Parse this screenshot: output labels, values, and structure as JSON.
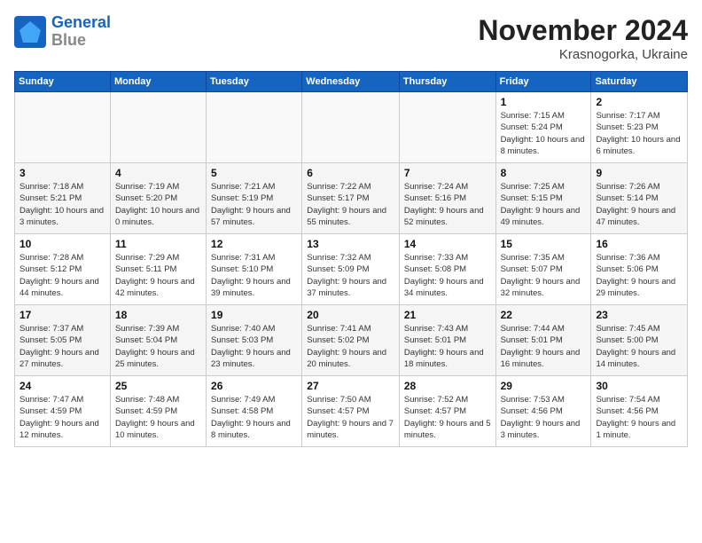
{
  "logo": {
    "line1": "General",
    "line2": "Blue"
  },
  "title": "November 2024",
  "location": "Krasnogorka, Ukraine",
  "days_header": [
    "Sunday",
    "Monday",
    "Tuesday",
    "Wednesday",
    "Thursday",
    "Friday",
    "Saturday"
  ],
  "weeks": [
    [
      {
        "day": "",
        "info": ""
      },
      {
        "day": "",
        "info": ""
      },
      {
        "day": "",
        "info": ""
      },
      {
        "day": "",
        "info": ""
      },
      {
        "day": "",
        "info": ""
      },
      {
        "day": "1",
        "info": "Sunrise: 7:15 AM\nSunset: 5:24 PM\nDaylight: 10 hours and 8 minutes."
      },
      {
        "day": "2",
        "info": "Sunrise: 7:17 AM\nSunset: 5:23 PM\nDaylight: 10 hours and 6 minutes."
      }
    ],
    [
      {
        "day": "3",
        "info": "Sunrise: 7:18 AM\nSunset: 5:21 PM\nDaylight: 10 hours and 3 minutes."
      },
      {
        "day": "4",
        "info": "Sunrise: 7:19 AM\nSunset: 5:20 PM\nDaylight: 10 hours and 0 minutes."
      },
      {
        "day": "5",
        "info": "Sunrise: 7:21 AM\nSunset: 5:19 PM\nDaylight: 9 hours and 57 minutes."
      },
      {
        "day": "6",
        "info": "Sunrise: 7:22 AM\nSunset: 5:17 PM\nDaylight: 9 hours and 55 minutes."
      },
      {
        "day": "7",
        "info": "Sunrise: 7:24 AM\nSunset: 5:16 PM\nDaylight: 9 hours and 52 minutes."
      },
      {
        "day": "8",
        "info": "Sunrise: 7:25 AM\nSunset: 5:15 PM\nDaylight: 9 hours and 49 minutes."
      },
      {
        "day": "9",
        "info": "Sunrise: 7:26 AM\nSunset: 5:14 PM\nDaylight: 9 hours and 47 minutes."
      }
    ],
    [
      {
        "day": "10",
        "info": "Sunrise: 7:28 AM\nSunset: 5:12 PM\nDaylight: 9 hours and 44 minutes."
      },
      {
        "day": "11",
        "info": "Sunrise: 7:29 AM\nSunset: 5:11 PM\nDaylight: 9 hours and 42 minutes."
      },
      {
        "day": "12",
        "info": "Sunrise: 7:31 AM\nSunset: 5:10 PM\nDaylight: 9 hours and 39 minutes."
      },
      {
        "day": "13",
        "info": "Sunrise: 7:32 AM\nSunset: 5:09 PM\nDaylight: 9 hours and 37 minutes."
      },
      {
        "day": "14",
        "info": "Sunrise: 7:33 AM\nSunset: 5:08 PM\nDaylight: 9 hours and 34 minutes."
      },
      {
        "day": "15",
        "info": "Sunrise: 7:35 AM\nSunset: 5:07 PM\nDaylight: 9 hours and 32 minutes."
      },
      {
        "day": "16",
        "info": "Sunrise: 7:36 AM\nSunset: 5:06 PM\nDaylight: 9 hours and 29 minutes."
      }
    ],
    [
      {
        "day": "17",
        "info": "Sunrise: 7:37 AM\nSunset: 5:05 PM\nDaylight: 9 hours and 27 minutes."
      },
      {
        "day": "18",
        "info": "Sunrise: 7:39 AM\nSunset: 5:04 PM\nDaylight: 9 hours and 25 minutes."
      },
      {
        "day": "19",
        "info": "Sunrise: 7:40 AM\nSunset: 5:03 PM\nDaylight: 9 hours and 23 minutes."
      },
      {
        "day": "20",
        "info": "Sunrise: 7:41 AM\nSunset: 5:02 PM\nDaylight: 9 hours and 20 minutes."
      },
      {
        "day": "21",
        "info": "Sunrise: 7:43 AM\nSunset: 5:01 PM\nDaylight: 9 hours and 18 minutes."
      },
      {
        "day": "22",
        "info": "Sunrise: 7:44 AM\nSunset: 5:01 PM\nDaylight: 9 hours and 16 minutes."
      },
      {
        "day": "23",
        "info": "Sunrise: 7:45 AM\nSunset: 5:00 PM\nDaylight: 9 hours and 14 minutes."
      }
    ],
    [
      {
        "day": "24",
        "info": "Sunrise: 7:47 AM\nSunset: 4:59 PM\nDaylight: 9 hours and 12 minutes."
      },
      {
        "day": "25",
        "info": "Sunrise: 7:48 AM\nSunset: 4:59 PM\nDaylight: 9 hours and 10 minutes."
      },
      {
        "day": "26",
        "info": "Sunrise: 7:49 AM\nSunset: 4:58 PM\nDaylight: 9 hours and 8 minutes."
      },
      {
        "day": "27",
        "info": "Sunrise: 7:50 AM\nSunset: 4:57 PM\nDaylight: 9 hours and 7 minutes."
      },
      {
        "day": "28",
        "info": "Sunrise: 7:52 AM\nSunset: 4:57 PM\nDaylight: 9 hours and 5 minutes."
      },
      {
        "day": "29",
        "info": "Sunrise: 7:53 AM\nSunset: 4:56 PM\nDaylight: 9 hours and 3 minutes."
      },
      {
        "day": "30",
        "info": "Sunrise: 7:54 AM\nSunset: 4:56 PM\nDaylight: 9 hours and 1 minute."
      }
    ]
  ]
}
